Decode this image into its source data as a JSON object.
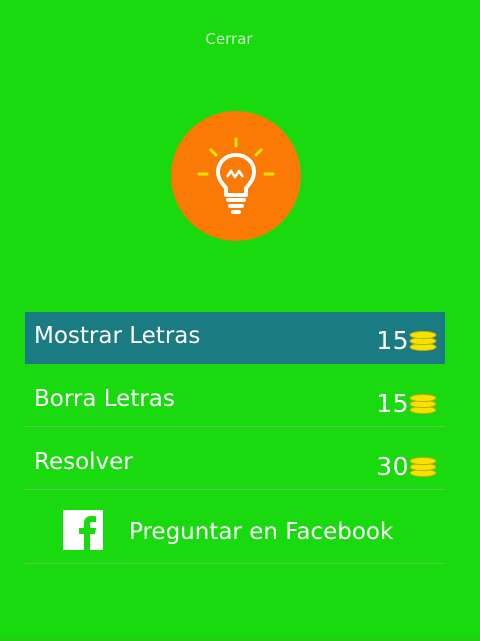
{
  "dialog": {
    "close_label": "Cerrar"
  },
  "hint_icon": {
    "icon": "lightbulb-icon",
    "circle_color": "#fb7a06",
    "bulb_color": "#ffffff",
    "ray_color": "#f5e800"
  },
  "options": [
    {
      "label": "Mostrar Letras",
      "cost": "15",
      "icon": "coins-icon"
    },
    {
      "label": "Borra Letras",
      "cost": "15",
      "icon": "coins-icon"
    },
    {
      "label": "Resolver",
      "cost": "30",
      "icon": "coins-icon"
    }
  ],
  "facebook": {
    "label": "Preguntar en Facebook",
    "icon": "facebook-icon"
  },
  "colors": {
    "background": "#19d90f",
    "selected_row": "#1a7b82",
    "coin": "#f5e200"
  }
}
